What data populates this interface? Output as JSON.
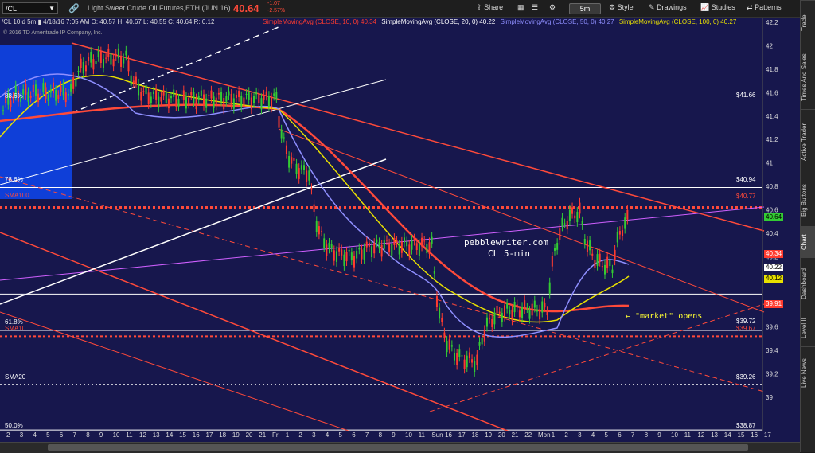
{
  "toolbar": {
    "symbol": "/CL",
    "product_name": "Light Sweet Crude Oil Futures,ETH (JUN 16)",
    "last_price": "40.64",
    "change": "-1.07",
    "change_pct": "-2.57%",
    "share": "Share",
    "interval": "5m",
    "style": "Style",
    "drawings": "Drawings",
    "studies": "Studies",
    "patterns": "Patterns"
  },
  "info_row": "/CL 10 d 5m  ▮ 4/18/16 7:05 AM  O: 40.57  H: 40.67  L: 40.55  C: 40.64  R: 0.12",
  "studies": [
    {
      "text": "SimpleMovingAvg (CLOSE, 10, 0)",
      "value": "40.34",
      "color": "#ff3b2f"
    },
    {
      "text": "SimpleMovingAvg (CLOSE, 20, 0)",
      "value": "40.22",
      "color": "#ffffff"
    },
    {
      "text": "SimpleMovingAvg (CLOSE, 50, 0)",
      "value": "40.27",
      "color": "#8f8fff"
    },
    {
      "text": "SimpleMovingAvg (CLOSE, 100, 0)",
      "value": "40.27",
      "color": "#e8e000"
    }
  ],
  "copyright": "© 2016 TD Ameritrade IP Company, Inc.",
  "price_axis": [
    "42.2",
    "42",
    "41.8",
    "41.6",
    "41.4",
    "41.2",
    "41",
    "40.8",
    "40.6",
    "40.4",
    "40.2",
    "40",
    "39.8",
    "39.6",
    "39.4",
    "39.2",
    "39"
  ],
  "level_labels": {
    "fib886": "88.6%",
    "fib786": "78.6%",
    "fib618": "61.8%",
    "fib500": "50.0%",
    "sma100": "SMA100",
    "sma10": "SMA10",
    "sma20": "SMA20",
    "p4166": "$41.66",
    "p4094": "$40.94",
    "p4077": "$40.77",
    "p3972": "$39.72",
    "p3967": "$39.67",
    "p3926": "$39.26",
    "p3887": "$38.87"
  },
  "badges": {
    "last": "40.64",
    "sma10": "40.34",
    "sma20": "40.22",
    "sma100": "40.12",
    "red": "39.91"
  },
  "annotations": {
    "site": "pebblewriter.com",
    "sub": "CL 5-min",
    "market": "← \"market\" opens"
  },
  "x_axis": [
    "2",
    "3",
    "4",
    "5",
    "6",
    "7",
    "8",
    "9",
    "10",
    "11",
    "12",
    "13",
    "14",
    "15",
    "16",
    "17",
    "18",
    "19",
    "20",
    "21",
    "Fri",
    "1",
    "2",
    "3",
    "4",
    "5",
    "6",
    "7",
    "8",
    "9",
    "10",
    "11",
    "Sun",
    "16",
    "17",
    "18",
    "19",
    "20",
    "21",
    "22",
    "Mon",
    "1",
    "2",
    "3",
    "4",
    "5",
    "6",
    "7",
    "8",
    "9",
    "10",
    "11",
    "12",
    "13",
    "14",
    "15",
    "16",
    "17"
  ],
  "right_rail": [
    "Trade",
    "Times And Sales",
    "Active Trader",
    "Big Buttons",
    "Chart",
    "Dashboard",
    "Level II",
    "Live News"
  ],
  "colors": {
    "background": "#17174d",
    "price": "#ff4a3a",
    "sma100": "#e8e000",
    "sma50": "#8f8fff"
  }
}
